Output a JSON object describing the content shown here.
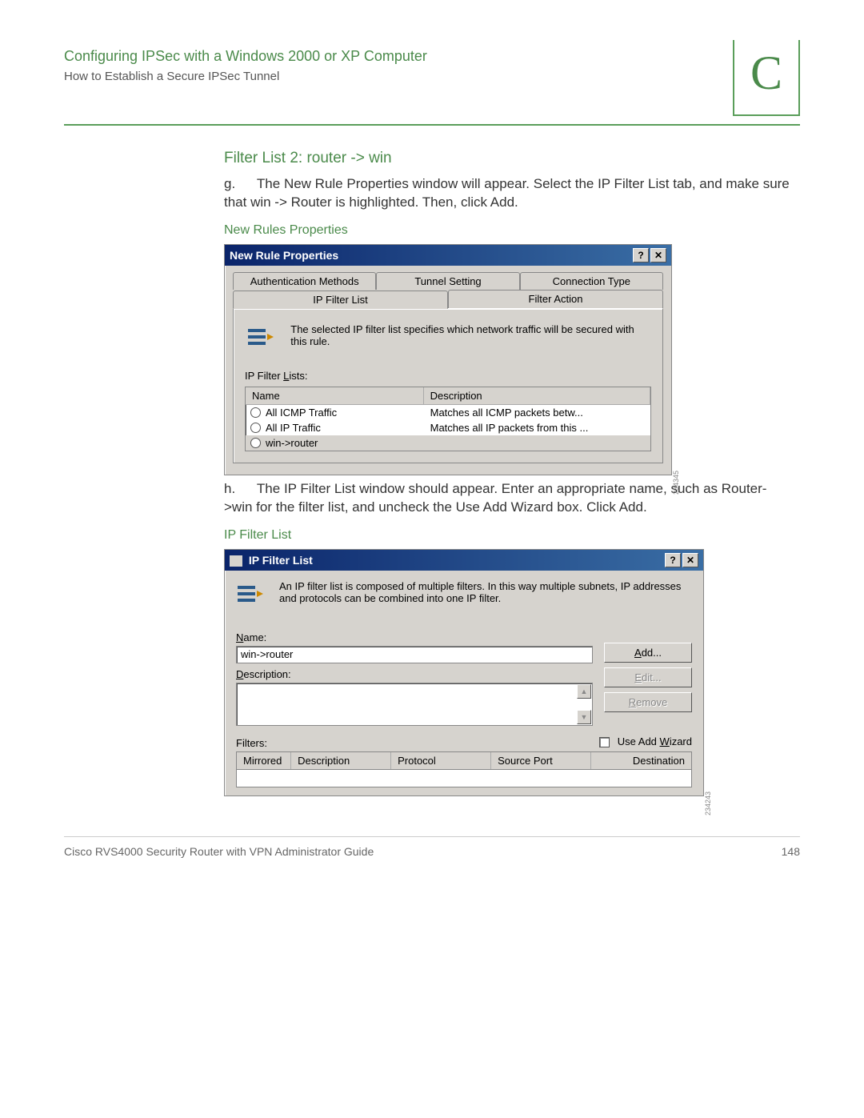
{
  "header": {
    "title": "Configuring IPSec with a Windows 2000 or XP Computer",
    "subtitle": "How to Establish a Secure IPSec Tunnel",
    "appendix_letter": "C"
  },
  "section1": {
    "heading": "Filter List 2: router -> win",
    "step_label": "g.",
    "step_text": "The New Rule Properties window will appear. Select the IP Filter List tab, and make sure that win -> Router is highlighted. Then, click Add.",
    "caption": "New Rules Properties"
  },
  "dialog1": {
    "title": "New Rule Properties",
    "tabs_back": [
      "Authentication Methods",
      "Tunnel Setting",
      "Connection Type"
    ],
    "tabs_front": [
      "IP Filter List",
      "Filter Action"
    ],
    "explain": "The selected IP filter list specifies which network traffic will be secured with this rule.",
    "lists_label": "IP Filter Lists:",
    "col_name": "Name",
    "col_desc": "Description",
    "rows": [
      {
        "name": "All ICMP Traffic",
        "desc": "Matches all ICMP packets betw..."
      },
      {
        "name": "All IP Traffic",
        "desc": "Matches all IP packets from this ..."
      },
      {
        "name": "win->router",
        "desc": ""
      }
    ],
    "imgnum": "234345"
  },
  "section2": {
    "step_label": "h.",
    "step_text": "The IP Filter List window should appear. Enter an appropriate name, such as Router->win for the filter list, and uncheck the Use Add Wizard box. Click Add.",
    "caption": "IP Filter List"
  },
  "dialog2": {
    "title": "IP Filter List",
    "explain": "An IP filter list is composed of multiple filters. In this way multiple subnets, IP addresses and protocols can be combined into one IP filter.",
    "name_label": "Name:",
    "name_value": "win->router",
    "desc_label": "Description:",
    "btn_add": "Add...",
    "btn_edit": "Edit...",
    "btn_remove": "Remove",
    "filters_label": "Filters:",
    "wizard_label": "Use Add Wizard",
    "cols": {
      "a": "Mirrored",
      "b": "Description",
      "c": "Protocol",
      "d": "Source Port",
      "e": "Destination"
    },
    "imgnum": "234243"
  },
  "footer": {
    "left": "Cisco RVS4000 Security Router with VPN Administrator Guide",
    "right": "148"
  }
}
